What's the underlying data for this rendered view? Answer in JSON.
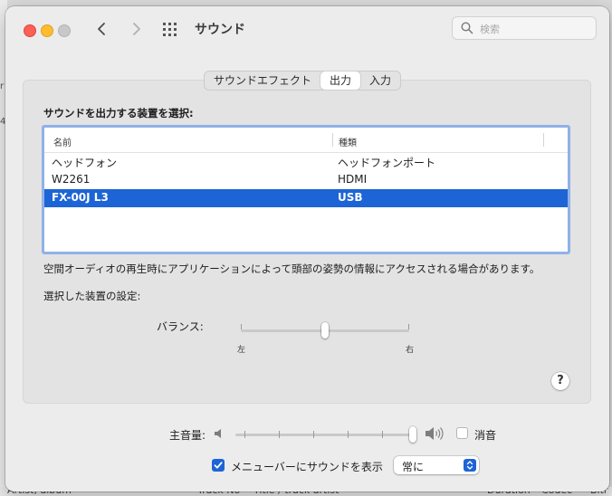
{
  "background": {
    "left_fragments": [
      "r",
      "4"
    ],
    "bottom_columns": [
      "Artist, album",
      "Track No",
      "Title / track artist",
      "Duration",
      "Codec",
      "Bitr"
    ]
  },
  "window": {
    "title": "サウンド",
    "search_placeholder": "検索"
  },
  "tabs": [
    {
      "label": "サウンドエフェクト",
      "selected": false
    },
    {
      "label": "出力",
      "selected": true
    },
    {
      "label": "入力",
      "selected": false
    }
  ],
  "output": {
    "section_title": "サウンドを出力する装置を選択:",
    "columns": {
      "name": "名前",
      "type": "種類"
    },
    "devices": [
      {
        "name": "ヘッドフォン",
        "type": "ヘッドフォンポート",
        "selected": false
      },
      {
        "name": "W2261",
        "type": "HDMI",
        "selected": false
      },
      {
        "name": "FX-00J L3",
        "type": "USB",
        "selected": true
      }
    ],
    "note": "空間オーディオの再生時にアプリケーションによって頭部の姿勢の情報にアクセスされる場合があります。",
    "settings_title": "選択した装置の設定:",
    "balance": {
      "label": "バランス:",
      "left_label": "左",
      "right_label": "右",
      "value": 0.5
    },
    "help_label": "?"
  },
  "volume": {
    "label": "主音量:",
    "level": 1.0,
    "mute_label": "消音",
    "muted": false
  },
  "menubar": {
    "show_label": "メニューバーにサウンドを表示",
    "checked": true,
    "popup_value": "常に"
  },
  "colors": {
    "accent": "#1d64d6",
    "selection": "#1d64d6",
    "focus_ring": "#8fb1e8",
    "close": "#fe5f57",
    "minimize": "#febc2e"
  }
}
